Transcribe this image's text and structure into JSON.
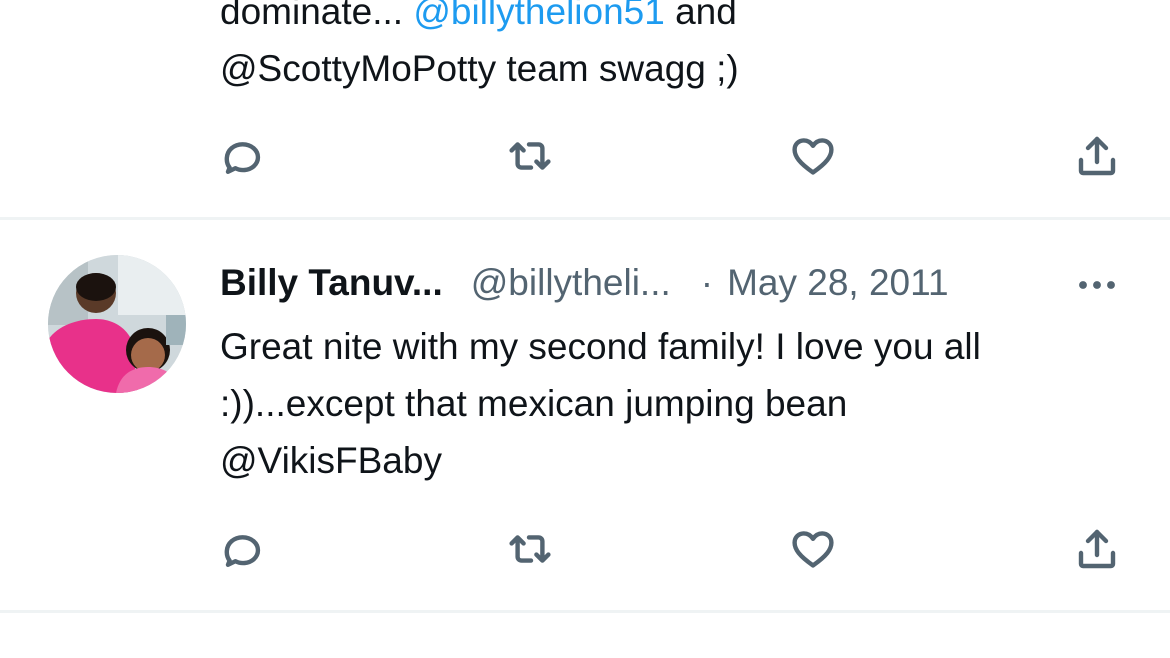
{
  "tweet1": {
    "line1_prefix": "dominate... ",
    "line1_mention": "@billythelion51",
    "line1_suffix": " and",
    "line2": "@ScottyMoPotty team swagg ;)"
  },
  "tweet2": {
    "display_name": "Billy Tanuv...",
    "handle": "@billytheli...",
    "separator": "·",
    "date": "May 28, 2011",
    "text_line1": "Great nite with my second family! I love you all",
    "text_line2": ":))...except that mexican jumping bean",
    "text_line3": "@VikisFBaby"
  },
  "icons": {
    "reply": "reply-icon",
    "retweet": "retweet-icon",
    "like": "heart-icon",
    "share": "share-icon",
    "more": "more-icon"
  },
  "colors": {
    "link": "#1d9bf0",
    "secondary_text": "#536471",
    "primary_text": "#0f1419",
    "divider": "#eff3f4",
    "avatar_shirt": "#e8318a"
  }
}
